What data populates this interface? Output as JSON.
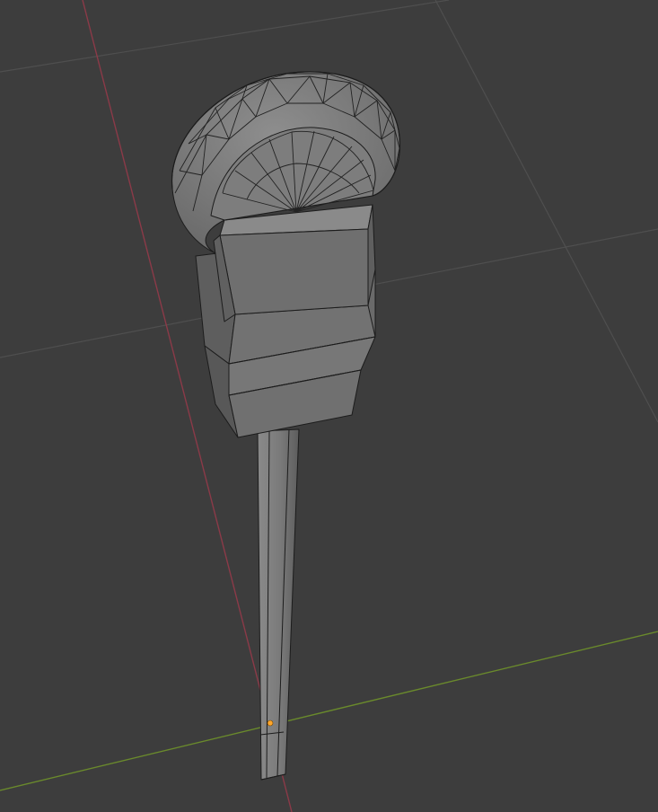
{
  "viewport": {
    "background": "#3d3d3d",
    "grid_color": "#4f4f4f",
    "x_axis_color": "#8b3a48",
    "y_axis_color": "#6a8a2c"
  },
  "object": {
    "kind": "parking-meter-mesh",
    "display": "solid-with-wireframe",
    "origin_marker_color": "#ffa62b"
  }
}
